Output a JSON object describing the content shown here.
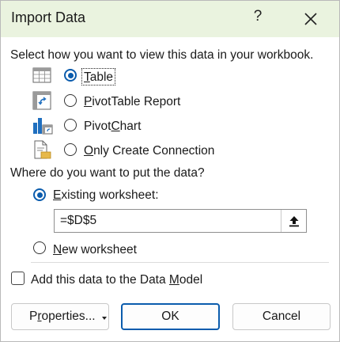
{
  "dialog": {
    "title": "Import Data",
    "help_label": "?",
    "close_icon": "close-icon"
  },
  "view_section": {
    "heading": "Select how you want to view this data in your workbook.",
    "options": [
      {
        "first": "T",
        "rest": "able",
        "icon": "table-icon",
        "selected": true
      },
      {
        "first": "P",
        "rest": "ivotTable Report",
        "icon": "pivottable-icon",
        "selected": false
      },
      {
        "first": "Pivot",
        "mid": "C",
        "rest": "hart",
        "icon": "pivotchart-icon",
        "selected": false
      },
      {
        "first": "O",
        "rest": "nly Create Connection",
        "icon": "connection-icon",
        "selected": false
      }
    ]
  },
  "location_section": {
    "heading": "Where do you want to put the data?",
    "existing": {
      "first": "E",
      "rest": "xisting worksheet:",
      "selected": true
    },
    "range_value": "=$D$5",
    "collapse_icon": "collapse-dialog-icon",
    "new": {
      "first": "N",
      "rest": "ew worksheet",
      "selected": false
    }
  },
  "data_model": {
    "label_before": "Add this data to the Data ",
    "label_underlined": "M",
    "label_after": "odel",
    "checked": false
  },
  "buttons": {
    "properties_before": "P",
    "properties_underlined": "r",
    "properties_after": "operties...",
    "ok": "OK",
    "cancel": "Cancel"
  },
  "colors": {
    "titlebar": "#eaf3df",
    "accent": "#0b5cad"
  }
}
